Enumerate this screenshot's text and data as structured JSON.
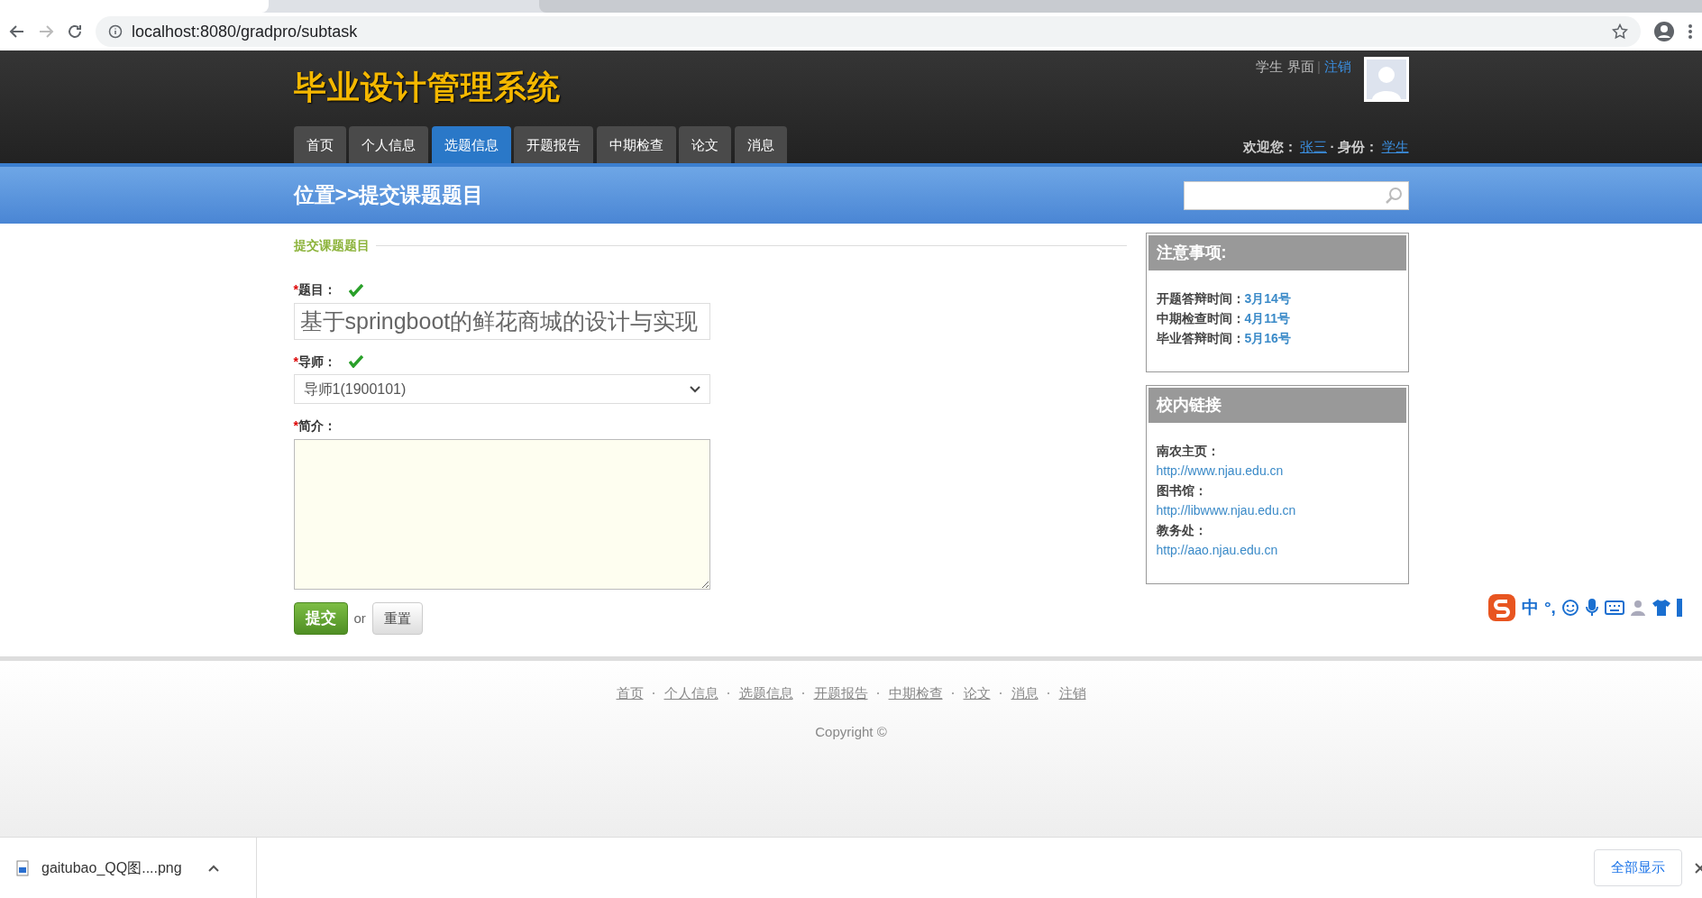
{
  "browser": {
    "url": "localhost:8080/gradpro/subtask"
  },
  "header": {
    "title": "毕业设计管理系统",
    "user_role_text": "学生 界面",
    "separator": "|",
    "logout": "注销",
    "welcome_label": "欢迎您：",
    "user_name": "张三",
    "dot": "·",
    "role_label": "身份：",
    "role": "学生"
  },
  "nav": [
    {
      "label": "首页",
      "selected": false
    },
    {
      "label": "个人信息",
      "selected": false
    },
    {
      "label": "选题信息",
      "selected": true
    },
    {
      "label": "开题报告",
      "selected": false
    },
    {
      "label": "中期检查",
      "selected": false
    },
    {
      "label": "论文",
      "selected": false
    },
    {
      "label": "消息",
      "selected": false
    }
  ],
  "breadcrumb": "位置>>提交课题题目",
  "form": {
    "legend": "提交课题题目",
    "fields": [
      {
        "kind": "text",
        "marker": "*",
        "label": "题目：",
        "valid": true,
        "value": "基于springboot的鲜花商城的设计与实现"
      },
      {
        "kind": "select",
        "marker": "*",
        "label": "导师：",
        "valid": true,
        "value": "导师1(1900101)"
      },
      {
        "kind": "textarea",
        "marker": "*",
        "label": "简介：",
        "valid": false
      }
    ],
    "submit": "提交",
    "or": "or",
    "reset": "重置"
  },
  "sidebar": [
    {
      "kind": "dates",
      "title": "注意事项:",
      "items": [
        {
          "label": "开题答辩时间：",
          "value": "3月14号"
        },
        {
          "label": "中期检查时间：",
          "value": "4月11号"
        },
        {
          "label": "毕业答辩时间：",
          "value": "5月16号"
        }
      ]
    },
    {
      "kind": "links",
      "title": "校内链接",
      "items": [
        {
          "label": "南农主页：",
          "value": "http://www.njau.edu.cn"
        },
        {
          "label": "图书馆：",
          "value": "http://libwww.njau.edu.cn"
        },
        {
          "label": "教务处：",
          "value": "http://aao.njau.edu.cn"
        }
      ]
    }
  ],
  "footer": {
    "links": [
      "首页",
      "个人信息",
      "选题信息",
      "开题报告",
      "中期检查",
      "论文",
      "消息",
      "注销"
    ],
    "copyright": "Copyright ©"
  },
  "ime": {
    "mode": "中",
    "punct": "°,"
  },
  "downloads": {
    "file": "gaitubao_QQ图....png",
    "show_all": "全部显示"
  }
}
